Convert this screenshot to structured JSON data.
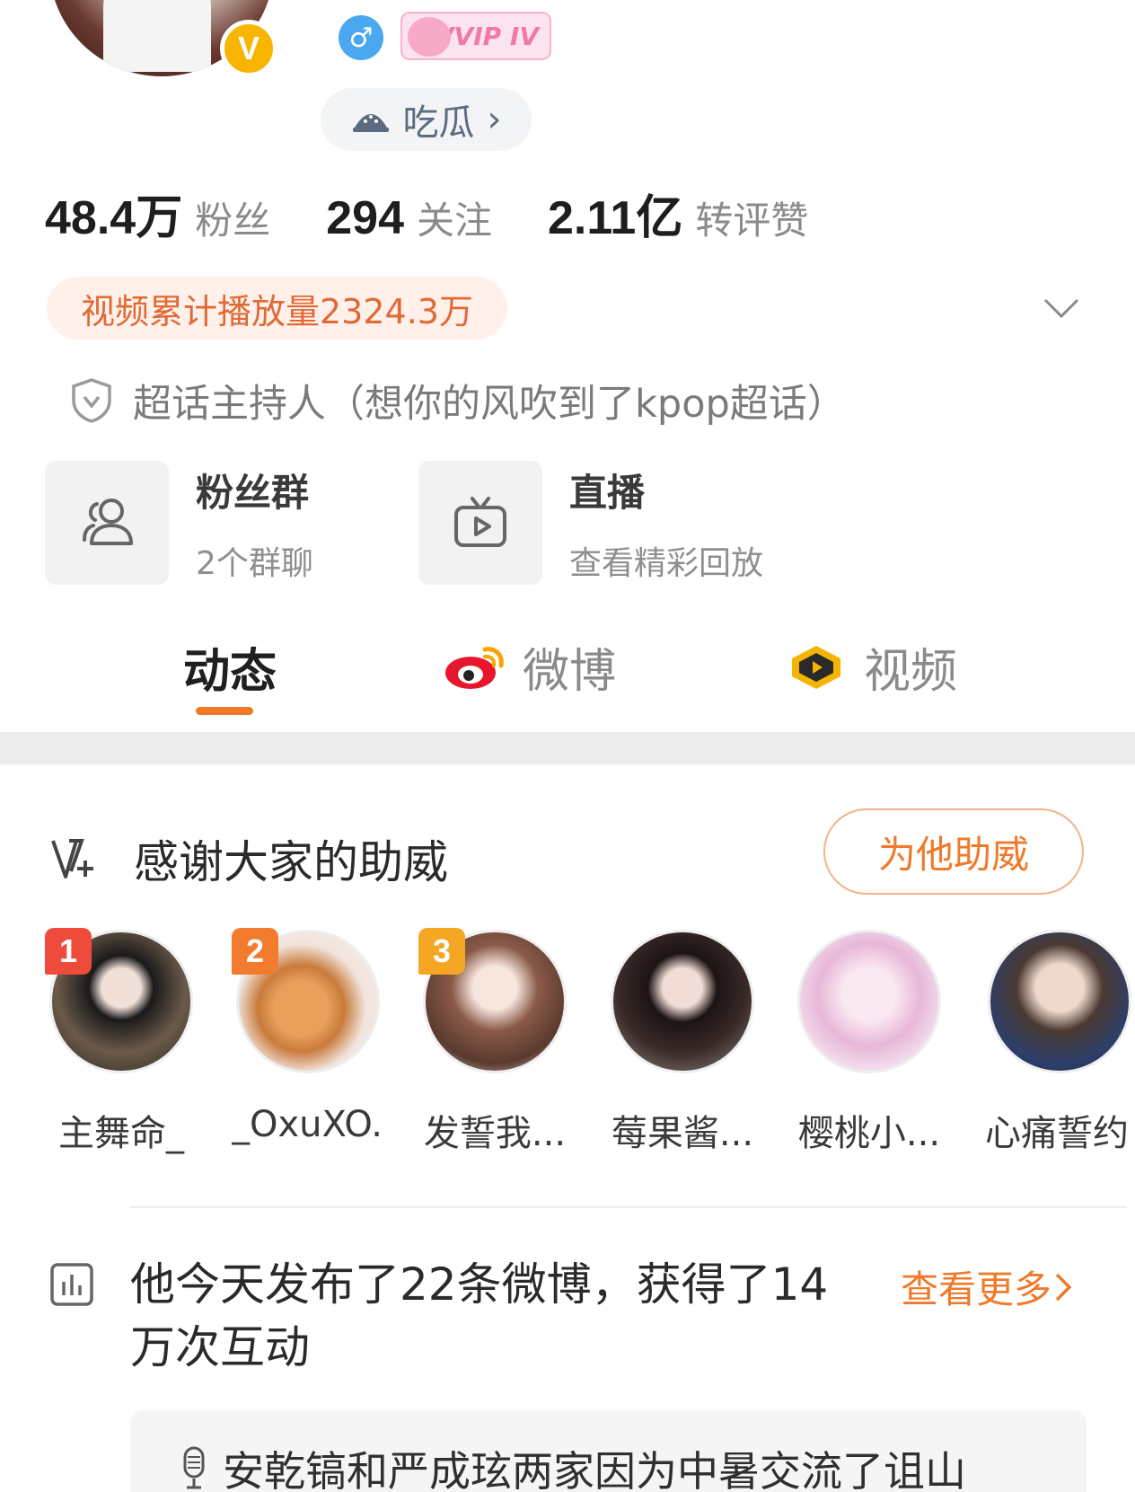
{
  "profile": {
    "verified_badge": "V",
    "gender_icon": "male-icon",
    "vip_badge": "VVIP IV",
    "tag_label": "吃瓜",
    "tag_chevron": "›"
  },
  "stats": [
    {
      "value": "48.4万",
      "label": "粉丝"
    },
    {
      "value": "294",
      "label": "关注"
    },
    {
      "value": "2.11亿",
      "label": "转评赞"
    }
  ],
  "play_count": "视频累计播放量2324.3万",
  "host_text": "超话主持人（想你的风吹到了kpop超话）",
  "cards": [
    {
      "title": "粉丝群",
      "subtitle": "2个群聊",
      "icon": "group-icon"
    },
    {
      "title": "直播",
      "subtitle": "查看精彩回放",
      "icon": "tv-icon"
    }
  ],
  "tabs": [
    {
      "label": "动态",
      "active": true
    },
    {
      "label": "微博",
      "icon": "weibo-icon"
    },
    {
      "label": "视频",
      "icon": "video-icon"
    }
  ],
  "support": {
    "title": "感谢大家的助威",
    "button": "为他助威",
    "fans": [
      {
        "rank": "1",
        "name": "主舞命_"
      },
      {
        "rank": "2",
        "name": "_OxuXO..."
      },
      {
        "rank": "3",
        "name": "发誓我..."
      },
      {
        "rank": "",
        "name": "莓果酱..."
      },
      {
        "rank": "",
        "name": "樱桃小..."
      },
      {
        "rank": "",
        "name": "心痛誓约"
      }
    ]
  },
  "today": {
    "text": "他今天发布了22条微博，获得了14万次互动",
    "more": "查看更多"
  },
  "hot_topic": "安乾镐和严成玹两家因为中暑交流了诅山",
  "colors": {
    "accent": "#ee7a2a",
    "rank1": "#ee4b3a",
    "rank2": "#f37b2e",
    "rank3": "#f5a623"
  }
}
